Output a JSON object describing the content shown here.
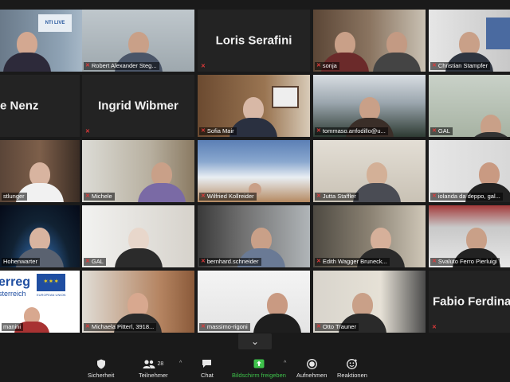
{
  "participants": [
    {
      "label": "",
      "big_name": "",
      "muted": false,
      "active": true
    },
    {
      "label": "Robert Alexander Steg...",
      "big_name": "",
      "muted": true
    },
    {
      "label": "",
      "big_name": "Loris Serafini",
      "muted": true
    },
    {
      "label": "sonja",
      "big_name": "",
      "muted": true
    },
    {
      "label": "Christian Stampfer",
      "big_name": "",
      "muted": true
    },
    {
      "label": "",
      "big_name": "chele Nenz",
      "muted": false
    },
    {
      "label": "",
      "big_name": "Ingrid Wibmer",
      "muted": true
    },
    {
      "label": "Sofia Mair",
      "big_name": "",
      "muted": true
    },
    {
      "label": "tommaso.anfodillo@u...",
      "big_name": "",
      "muted": true
    },
    {
      "label": "GAL",
      "big_name": "",
      "muted": true
    },
    {
      "label": "stlunger",
      "big_name": "",
      "muted": false
    },
    {
      "label": "Michele",
      "big_name": "",
      "muted": true
    },
    {
      "label": "Wilfried Kollreider",
      "big_name": "",
      "muted": true
    },
    {
      "label": "Jutta Staffler",
      "big_name": "",
      "muted": true
    },
    {
      "label": "iolanda da deppo, gal...",
      "big_name": "",
      "muted": true
    },
    {
      "label": "Hohenwarter",
      "big_name": "",
      "muted": false
    },
    {
      "label": "GAL",
      "big_name": "",
      "muted": true
    },
    {
      "label": "bernhard.schneider",
      "big_name": "",
      "muted": true
    },
    {
      "label": "Edith Wagger Bruneck...",
      "big_name": "",
      "muted": true
    },
    {
      "label": "Svaluto Ferro Pierluigi",
      "big_name": "",
      "muted": true
    },
    {
      "label": "manini",
      "big_name": "",
      "muted": false
    },
    {
      "label": "Michaela Pitterl, 3918...",
      "big_name": "",
      "muted": true
    },
    {
      "label": "massimo-rigoni",
      "big_name": "",
      "muted": true
    },
    {
      "label": "Otto Trauner",
      "big_name": "",
      "muted": true
    },
    {
      "label": "",
      "big_name": "Fabio Ferdina",
      "muted": true
    }
  ],
  "tile_text": {
    "interreg_line1": "erreg",
    "interreg_line2": "sterreich",
    "eu_label": "EUROPEAN UNION",
    "banner_text": "NTI LIVE"
  },
  "toolbar": {
    "security": "Sicherheit",
    "participants": "Teilnehmer",
    "participants_count": "28",
    "chat": "Chat",
    "share": "Bildschirm freigeben",
    "record": "Aufnehmen",
    "reactions": "Reaktionen"
  },
  "colors": {
    "active_border": "#e6e255",
    "muted_icon": "#e03a3a",
    "share_green": "#3ec24b"
  }
}
